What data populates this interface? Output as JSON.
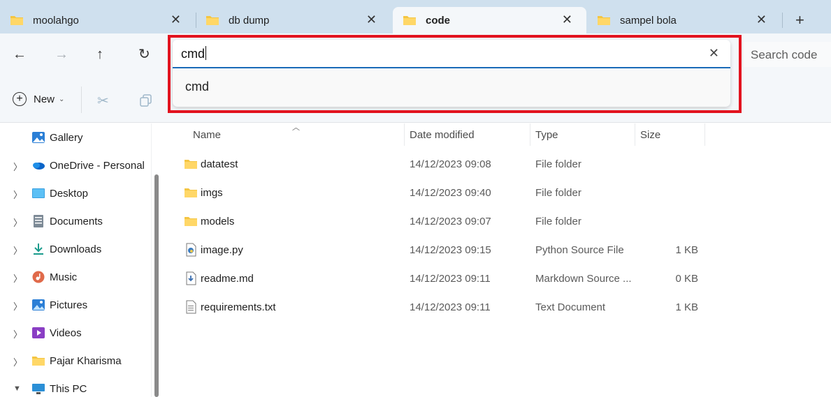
{
  "tabs": [
    {
      "label": "moolahgo",
      "close": "✕"
    },
    {
      "label": "db dump",
      "close": "✕"
    },
    {
      "label": "code",
      "close": "✕"
    },
    {
      "label": "sampel bola",
      "close": "✕"
    }
  ],
  "active_tab": "code",
  "new_tab_glyph": "+",
  "nav": {
    "back": "←",
    "forward": "→",
    "up": "↑",
    "refresh": "↻"
  },
  "search": {
    "placeholder": "Search code"
  },
  "command_bar": {
    "new_label": "New"
  },
  "address_search": {
    "value": "cmd",
    "clear": "✕",
    "suggestion": "cmd"
  },
  "sidebar": {
    "items": [
      {
        "label": "Gallery",
        "icon": "gallery-icon",
        "expandable": false
      },
      {
        "label": "OneDrive - Personal",
        "icon": "onedrive-icon",
        "expandable": true
      },
      {
        "label": "Desktop",
        "icon": "desktop-icon",
        "expandable": true
      },
      {
        "label": "Documents",
        "icon": "documents-icon",
        "expandable": true
      },
      {
        "label": "Downloads",
        "icon": "downloads-icon",
        "expandable": true
      },
      {
        "label": "Music",
        "icon": "music-icon",
        "expandable": true
      },
      {
        "label": "Pictures",
        "icon": "pictures-icon",
        "expandable": true
      },
      {
        "label": "Videos",
        "icon": "videos-icon",
        "expandable": true
      },
      {
        "label": "Pajar Kharisma",
        "icon": "folder-icon",
        "expandable": true
      },
      {
        "label": "This PC",
        "icon": "this-pc-icon",
        "expandable": true,
        "expanded": true
      }
    ]
  },
  "columns": {
    "name": "Name",
    "date": "Date modified",
    "type": "Type",
    "size": "Size"
  },
  "files": [
    {
      "name": "datatest",
      "date": "14/12/2023 09:08",
      "type": "File folder",
      "size": "",
      "icon": "folder-icon"
    },
    {
      "name": "imgs",
      "date": "14/12/2023 09:40",
      "type": "File folder",
      "size": "",
      "icon": "folder-icon"
    },
    {
      "name": "models",
      "date": "14/12/2023 09:07",
      "type": "File folder",
      "size": "",
      "icon": "folder-icon"
    },
    {
      "name": "image.py",
      "date": "14/12/2023 09:15",
      "type": "Python Source File",
      "size": "1 KB",
      "icon": "python-file-icon"
    },
    {
      "name": "readme.md",
      "date": "14/12/2023 09:11",
      "type": "Markdown Source ...",
      "size": "0 KB",
      "icon": "markdown-file-icon"
    },
    {
      "name": "requirements.txt",
      "date": "14/12/2023 09:11",
      "type": "Text Document",
      "size": "1 KB",
      "icon": "text-file-icon"
    }
  ],
  "colors": {
    "accent": "#1a6bb8",
    "highlight_box": "#e2131f",
    "folder": "#f4c542",
    "tab_strip": "#cfe0ee"
  }
}
